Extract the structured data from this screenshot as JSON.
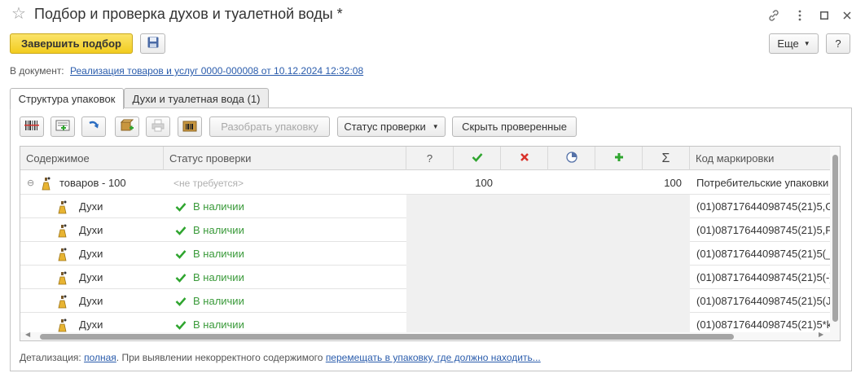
{
  "window": {
    "title": "Подбор и проверка духов и туалетной воды *"
  },
  "toolbar": {
    "finish_label": "Завершить подбор",
    "more_label": "Еще",
    "help_label": "?"
  },
  "document": {
    "label": "В документ:",
    "link": "Реализация товаров и услуг 0000-000008 от 10.12.2024 12:32:08"
  },
  "tabs": [
    {
      "label": "Структура упаковок",
      "active": true
    },
    {
      "label": "Духи и туалетная вода (1)",
      "active": false
    }
  ],
  "grid_toolbar": {
    "unpack_label": "Разобрать упаковку",
    "status_label": "Статус проверки",
    "hide_checked_label": "Скрыть проверенные"
  },
  "grid": {
    "columns": {
      "content": "Содержимое",
      "status": "Статус проверки",
      "unknown": "?",
      "sum": "Σ",
      "code": "Код маркировки"
    },
    "group_row": {
      "content": "товаров - 100",
      "status": "<не требуется>",
      "checked": "100",
      "total": "100",
      "code": "Потребительские упаковки"
    },
    "rows": [
      {
        "content": "Духи",
        "status": "В наличии",
        "code": "(01)08717644098745(21)5,G"
      },
      {
        "content": "Духи",
        "status": "В наличии",
        "code": "(01)08717644098745(21)5,Pl"
      },
      {
        "content": "Духи",
        "status": "В наличии",
        "code": "(01)08717644098745(21)5(_("
      },
      {
        "content": "Духи",
        "status": "В наличии",
        "code": "(01)08717644098745(21)5(-)l"
      },
      {
        "content": "Духи",
        "status": "В наличии",
        "code": "(01)08717644098745(21)5(Jn"
      },
      {
        "content": "Духи",
        "status": "В наличии",
        "code": "(01)08717644098745(21)5*kl"
      }
    ]
  },
  "footer": {
    "prefix": "Детализация:",
    "detail_link": "полная",
    "middle": ". При выявлении некорректного содержимого",
    "action_link": "перемещать в упаковку, где должно находить..."
  },
  "colors": {
    "primary_button": "#f2cc1e",
    "link": "#2a5cac",
    "ok_green": "#3a9a3a",
    "error_red": "#d9322b",
    "add_green": "#2fa52f"
  }
}
